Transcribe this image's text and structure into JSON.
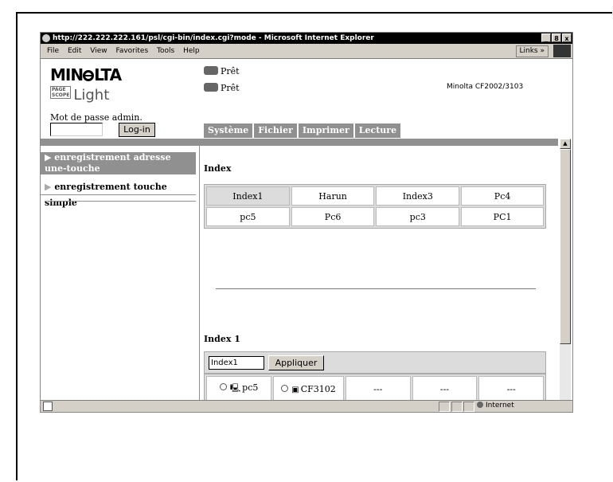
{
  "window": {
    "title": "http://222.222.222.161/psl/cgi-bin/index.cgi?mode - Microsoft Internet Explorer",
    "buttons": [
      "_",
      "8",
      "x"
    ]
  },
  "menu": {
    "items": [
      "File",
      "Edit",
      "View",
      "Favorites",
      "Tools",
      "Help"
    ],
    "links_label": "Links"
  },
  "header": {
    "brand": "MIN",
    "brand_tail": "LTA",
    "pagescope_top": "PAGE",
    "pagescope_bottom": "SCOPE",
    "pagescope_light": "Light",
    "status1": "Prêt",
    "status2": "Prêt",
    "model": "Minolta CF2002/3103",
    "password_label": "Mot de passe admin.",
    "login_button": "Log-in"
  },
  "tabs": [
    "Système",
    "Fichier",
    "Imprimer",
    "Lecture"
  ],
  "sidebar": {
    "items": [
      {
        "label": "enregistrement adresse une-touche",
        "active": true
      },
      {
        "label": "enregistrement touche simple",
        "active": false
      }
    ]
  },
  "index_section": {
    "heading": "Index",
    "rows": [
      [
        "Index1",
        "Harun",
        "Index3",
        "Pc4"
      ],
      [
        "pc5",
        "Pc6",
        "pc3",
        "PC1"
      ]
    ],
    "selected": "Index1"
  },
  "index1_section": {
    "heading": "Index 1",
    "name_value": "Index1",
    "apply_button": "Appliquer",
    "rows": [
      [
        "pc5",
        "CF3102",
        "---",
        "---",
        "---"
      ],
      [
        "---",
        "---",
        "---",
        "---",
        "---"
      ],
      [
        "---",
        "---",
        "---",
        "---",
        "---"
      ]
    ]
  },
  "statusbar": {
    "zone": "Internet"
  }
}
